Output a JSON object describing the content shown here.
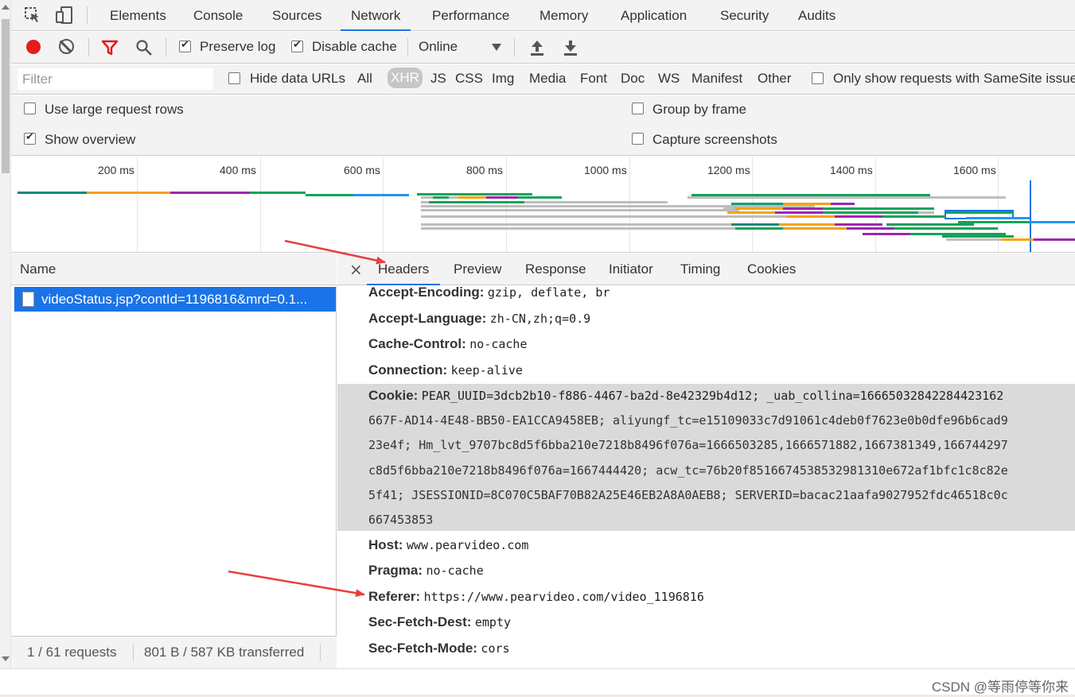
{
  "devtools": {
    "panel_tabs": [
      "Elements",
      "Console",
      "Sources",
      "Network",
      "Performance",
      "Memory",
      "Application",
      "Security",
      "Audits"
    ],
    "active_panel": "Network"
  },
  "toolbar": {
    "preserve_log": "Preserve log",
    "disable_cache": "Disable cache",
    "throttle_value": "Online",
    "preserve_log_checked": true,
    "disable_cache_checked": true
  },
  "filter": {
    "placeholder": "Filter",
    "hide_data_urls": "Hide data URLs",
    "types": [
      "All",
      "XHR",
      "JS",
      "CSS",
      "Img",
      "Media",
      "Font",
      "Doc",
      "WS",
      "Manifest",
      "Other"
    ],
    "active_type": "XHR",
    "samesite_label": "Only show requests with SameSite issues"
  },
  "settings": {
    "large_rows": "Use large request rows",
    "show_overview": "Show overview",
    "group_by_frame": "Group by frame",
    "capture_screenshots": "Capture screenshots"
  },
  "overview": {
    "ticks": [
      "200 ms",
      "400 ms",
      "600 ms",
      "800 ms",
      "1000 ms",
      "1200 ms",
      "1400 ms",
      "1600 ms"
    ]
  },
  "requests": {
    "column_name": "Name",
    "items": [
      {
        "name": "videoStatus.jsp?contId=1196816&mrd=0.1..."
      }
    ],
    "status_count": "1 / 61 requests",
    "status_transfer": "801 B / 587 KB transferred"
  },
  "details": {
    "tabs": [
      "Headers",
      "Preview",
      "Response",
      "Initiator",
      "Timing",
      "Cookies"
    ],
    "active_tab": "Headers",
    "headers": [
      {
        "key": "Accept-Encoding:",
        "value": "gzip, deflate, br"
      },
      {
        "key": "Accept-Language:",
        "value": "zh-CN,zh;q=0.9"
      },
      {
        "key": "Cache-Control:",
        "value": "no-cache"
      },
      {
        "key": "Connection:",
        "value": "keep-alive"
      },
      {
        "key": "Cookie:",
        "value": "PEAR_UUID=3dcb2b10-f886-4467-ba2d-8e42329b4d12; _uab_collina=16665032842284423162"
      },
      {
        "key": "Host:",
        "value": "www.pearvideo.com"
      },
      {
        "key": "Pragma:",
        "value": "no-cache"
      },
      {
        "key": "Referer:",
        "value": "https://www.pearvideo.com/video_1196816"
      },
      {
        "key": "Sec-Fetch-Dest:",
        "value": "empty"
      },
      {
        "key": "Sec-Fetch-Mode:",
        "value": "cors"
      }
    ],
    "cookie_lines": [
      "667F-AD14-4E48-BB50-EA1CCA9458EB; aliyungf_tc=e15109033c7d91061c4deb0f7623e0b0dfe96b6cad9",
      "23e4f; Hm_lvt_9707bc8d5f6bba210e7218b8496f076a=1666503285,1666571882,1667381349,166744297",
      "c8d5f6bba210e7218b8496f076a=1667444420; acw_tc=76b20f8516674538532981310e672af1bfc1c8c82e",
      "5f41; JSESSIONID=8C070C5BAF70B82A25E46EB2A8A0AEB8; SERVERID=bacac21aafa9027952fdc46518c0c",
      "667453853"
    ]
  },
  "watermark": "CSDN @等雨停等你来",
  "colors": {
    "accent": "#1a73e8",
    "record": "#e51c1c",
    "filter_icon": "#e51c1c",
    "annotation_arrow": "#e8403a"
  }
}
